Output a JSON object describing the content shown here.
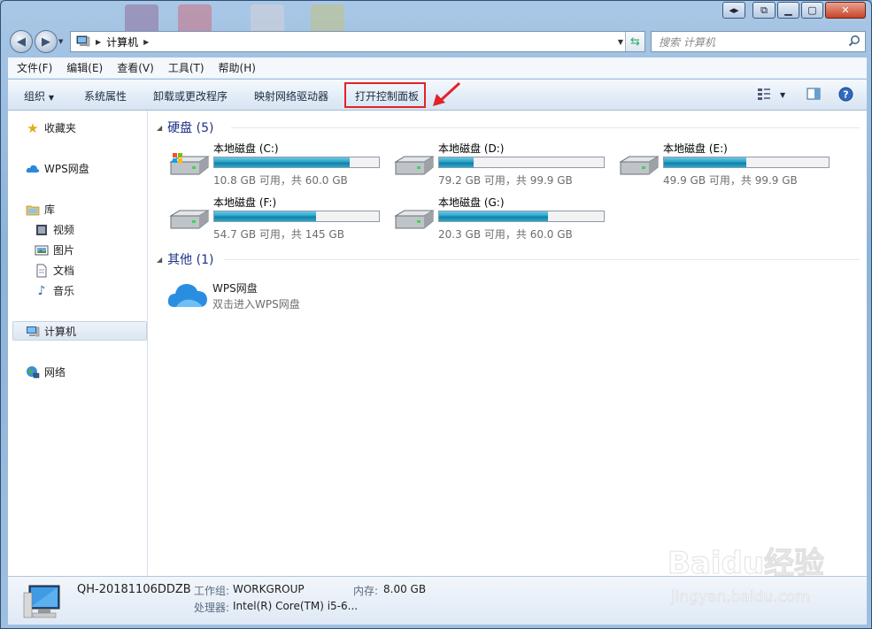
{
  "window": {
    "breadcrumb": [
      "计算机"
    ],
    "search_placeholder": "搜索 计算机"
  },
  "menu": [
    "文件(F)",
    "编辑(E)",
    "查看(V)",
    "工具(T)",
    "帮助(H)"
  ],
  "commands": {
    "organize": "组织",
    "system_properties": "系统属性",
    "uninstall": "卸载或更改程序",
    "map_drive": "映射网络驱动器",
    "open_control_panel": "打开控制面板"
  },
  "nav_pane": {
    "favorites": "收藏夹",
    "wps_drive": "WPS网盘",
    "libraries": "库",
    "videos": "视频",
    "pictures": "图片",
    "documents": "文档",
    "music": "音乐",
    "computer": "计算机",
    "network": "网络"
  },
  "groups": {
    "hard_disks": "硬盘 (5)",
    "other": "其他 (1)"
  },
  "drives": [
    {
      "name": "本地磁盘 (C:)",
      "free_text": "10.8 GB 可用，共 60.0 GB",
      "used_fraction": 0.82,
      "system": true
    },
    {
      "name": "本地磁盘 (D:)",
      "free_text": "79.2 GB 可用，共 99.9 GB",
      "used_fraction": 0.21,
      "system": false
    },
    {
      "name": "本地磁盘 (E:)",
      "free_text": "49.9 GB 可用，共 99.9 GB",
      "used_fraction": 0.5,
      "system": false
    },
    {
      "name": "本地磁盘 (F:)",
      "free_text": "54.7 GB 可用，共 145 GB",
      "used_fraction": 0.62,
      "system": false
    },
    {
      "name": "本地磁盘 (G:)",
      "free_text": "20.3 GB 可用，共 60.0 GB",
      "used_fraction": 0.66,
      "system": false
    }
  ],
  "other_items": [
    {
      "name": "WPS网盘",
      "desc": "双击进入WPS网盘"
    }
  ],
  "details": {
    "computer_name": "QH-20181106DDZB",
    "workgroup_label": "工作组:",
    "workgroup": "WORKGROUP",
    "memory_label": "内存:",
    "memory": "8.00 GB",
    "cpu_label": "处理器:",
    "cpu": "Intel(R) Core(TM) i5-6..."
  },
  "watermark": {
    "brand": "Baidu经验",
    "url": "jingyan.baidu.com"
  },
  "colors": {
    "highlight_box": "#e0242a",
    "group_header": "#1e3287",
    "drive_bar": "#27a4c8"
  }
}
